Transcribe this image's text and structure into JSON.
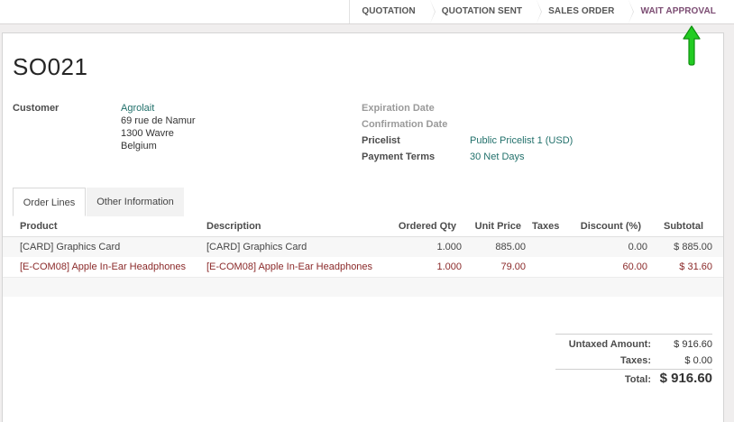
{
  "statusbar": {
    "steps": [
      {
        "label": "QUOTATION"
      },
      {
        "label": "QUOTATION SENT"
      },
      {
        "label": "SALES ORDER"
      },
      {
        "label": "WAIT APPROVAL"
      }
    ]
  },
  "order": {
    "title": "SO021",
    "customer_label": "Customer",
    "customer_name": "Agrolait",
    "address": [
      "69 rue de Namur",
      "1300 Wavre",
      "Belgium"
    ],
    "expiration_label": "Expiration Date",
    "confirmation_label": "Confirmation Date",
    "pricelist_label": "Pricelist",
    "pricelist_value": "Public Pricelist 1 (USD)",
    "payment_terms_label": "Payment Terms",
    "payment_terms_value": "30 Net Days"
  },
  "tabs": [
    "Order Lines",
    "Other Information"
  ],
  "grid": {
    "columns": [
      "Product",
      "Description",
      "Ordered Qty",
      "Unit Price",
      "Taxes",
      "Discount (%)",
      "Subtotal"
    ],
    "rows": [
      {
        "product": "[CARD] Graphics Card",
        "description": "[CARD] Graphics Card",
        "qty": "1.000",
        "price": "885.00",
        "taxes": "",
        "discount": "0.00",
        "subtotal": "$ 885.00"
      },
      {
        "product": "[E-COM08] Apple In-Ear Headphones",
        "description": "[E-COM08] Apple In-Ear Headphones",
        "qty": "1.000",
        "price": "79.00",
        "taxes": "",
        "discount": "60.00",
        "subtotal": "$ 31.60"
      }
    ]
  },
  "totals": {
    "untaxed_label": "Untaxed Amount:",
    "untaxed_value": "$ 916.60",
    "taxes_label": "Taxes:",
    "taxes_value": "$ 0.00",
    "total_label": "Total:",
    "total_value": "$ 916.60"
  },
  "colors": {
    "accent_link": "#21706b",
    "active_step": "#7c4d73",
    "highlight_row_text": "#8b2a2a",
    "arrow_green": "#22cc22"
  }
}
